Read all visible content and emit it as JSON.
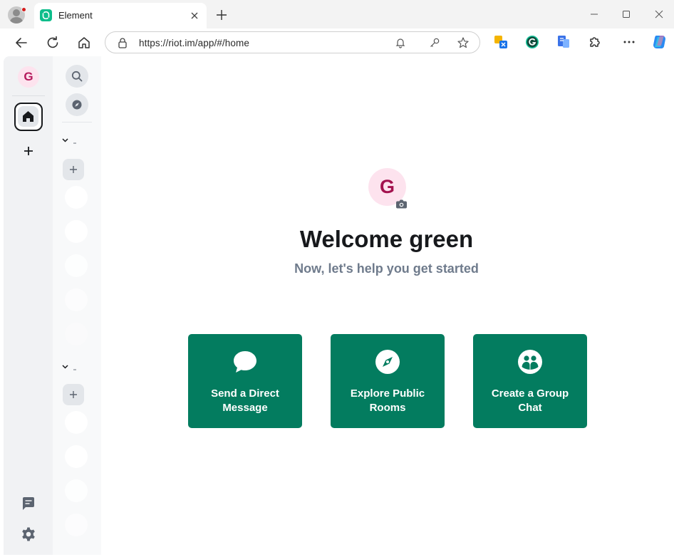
{
  "browser": {
    "tab_title": "Element",
    "url": "https://riot.im/app/#/home"
  },
  "user": {
    "avatar_initial": "G"
  },
  "home": {
    "title": "Welcome green",
    "subtitle": "Now, let's help you get started",
    "actions": [
      {
        "label": "Send a Direct Message",
        "icon": "chat-bubble-icon"
      },
      {
        "label": "Explore Public Rooms",
        "icon": "compass-icon"
      },
      {
        "label": "Create a Group Chat",
        "icon": "group-icon"
      }
    ]
  },
  "colors": {
    "accent": "#037c5f",
    "avatar_bg": "#fde3ee",
    "avatar_fg": "#a3124e"
  }
}
